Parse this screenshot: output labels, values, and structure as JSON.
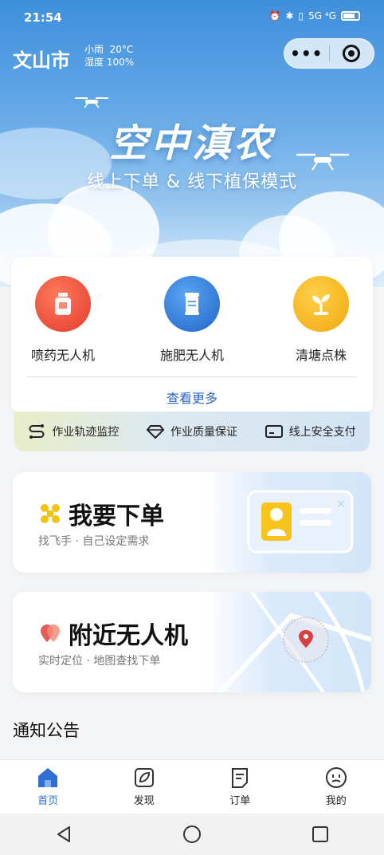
{
  "status_bar": {
    "time": "21:54",
    "network": "5G ⁴G"
  },
  "header": {
    "city": "文山市",
    "weather_condition": "小雨",
    "temperature": "20°C",
    "humidity": "湿度 100%",
    "capsule_more": "•••"
  },
  "hero": {
    "title": "空中滇农",
    "subtitle": "线上下单 & 线下植保模式"
  },
  "services": [
    {
      "label": "喷药无人机",
      "icon": "spray-bottle-icon",
      "color": "#e8453a"
    },
    {
      "label": "施肥无人机",
      "icon": "fertilizer-icon",
      "color": "#2f7ad8"
    },
    {
      "label": "清塘点株",
      "icon": "seedling-icon",
      "color": "#f2b21a"
    }
  ],
  "view_more": "查看更多",
  "guarantees": [
    {
      "label": "作业轨迹监控",
      "icon": "route-icon"
    },
    {
      "label": "作业质量保证",
      "icon": "diamond-icon"
    },
    {
      "label": "线上安全支付",
      "icon": "card-icon"
    }
  ],
  "cards": {
    "order": {
      "title": "我要下单",
      "subtitle": "找飞手 · 自己设定需求"
    },
    "nearby": {
      "title": "附近无人机",
      "subtitle": "实时定位 · 地图查找下单"
    }
  },
  "notice": {
    "title": "通知公告"
  },
  "tabs": [
    {
      "label": "首页",
      "icon": "home-icon",
      "active": true
    },
    {
      "label": "发现",
      "icon": "discover-icon",
      "active": false
    },
    {
      "label": "订单",
      "icon": "order-icon",
      "active": false
    },
    {
      "label": "我的",
      "icon": "profile-icon",
      "active": false
    }
  ],
  "colors": {
    "accent": "#2f6fd3",
    "link": "#2a66c8"
  }
}
